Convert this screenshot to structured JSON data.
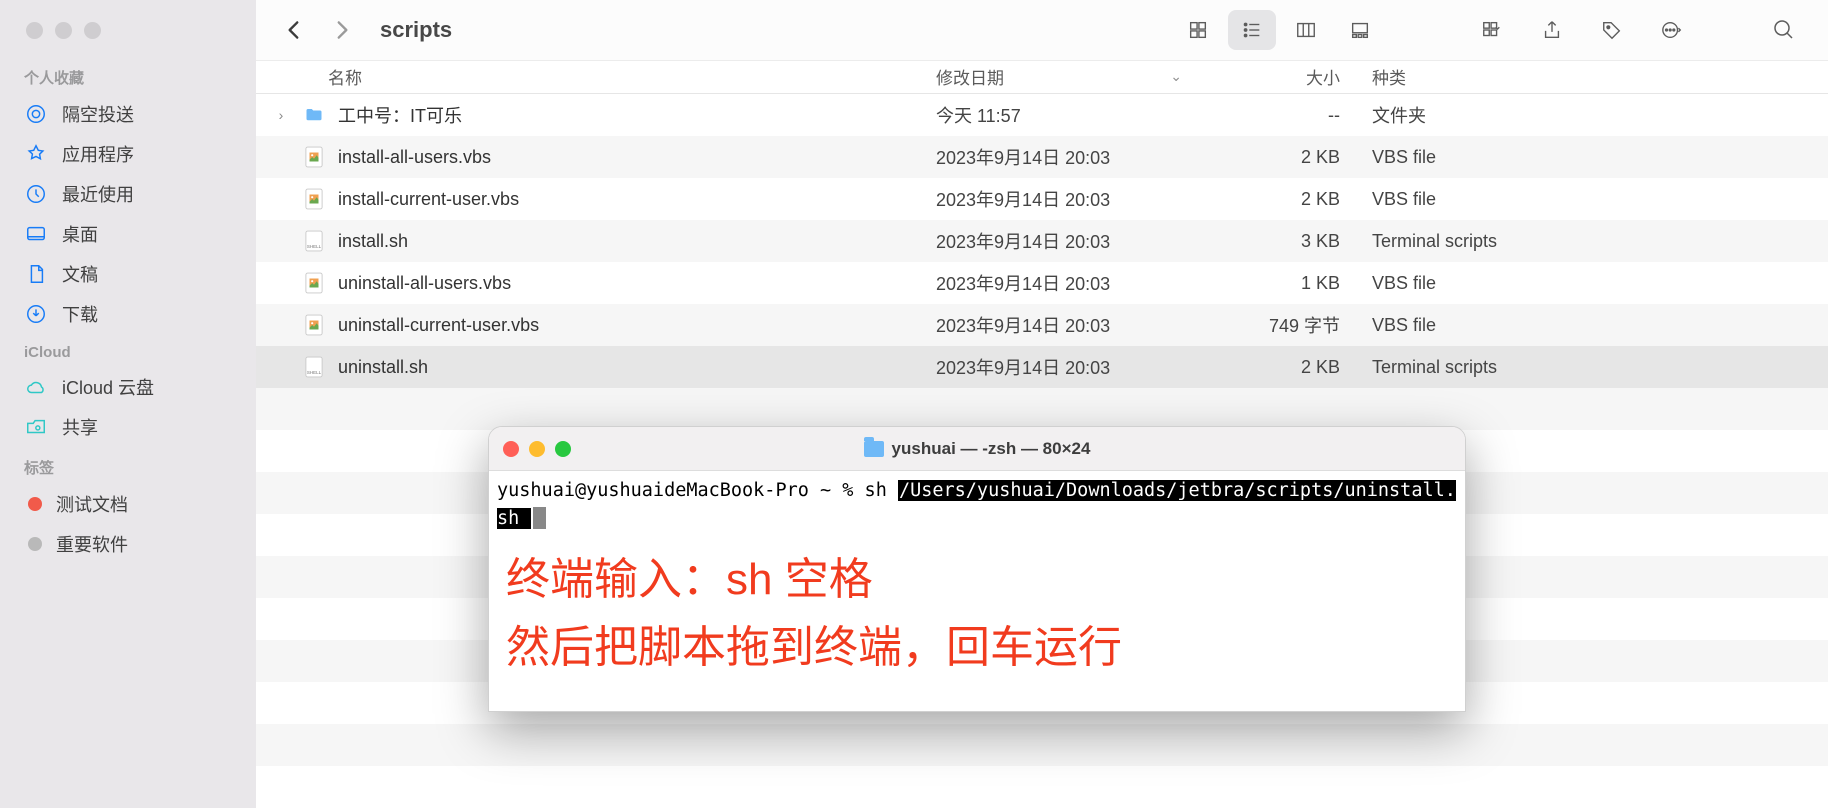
{
  "sidebar": {
    "sections": [
      {
        "label": "个人收藏",
        "items": [
          {
            "icon": "airdrop",
            "label": "隔空投送"
          },
          {
            "icon": "apps",
            "label": "应用程序"
          },
          {
            "icon": "recent",
            "label": "最近使用"
          },
          {
            "icon": "desktop",
            "label": "桌面"
          },
          {
            "icon": "documents",
            "label": "文稿"
          },
          {
            "icon": "downloads",
            "label": "下载"
          }
        ]
      },
      {
        "label": "iCloud",
        "items": [
          {
            "icon": "icloud",
            "label": "iCloud 云盘"
          },
          {
            "icon": "shared",
            "label": "共享"
          }
        ]
      },
      {
        "label": "标签",
        "items": [
          {
            "icon": "tag-red",
            "label": "测试文档",
            "color": "#f15a4a"
          },
          {
            "icon": "tag-gray",
            "label": "重要软件",
            "color": "#b9b9b9"
          }
        ]
      }
    ]
  },
  "toolbar": {
    "title": "scripts"
  },
  "columns": {
    "name": "名称",
    "date": "修改日期",
    "size": "大小",
    "kind": "种类"
  },
  "rows": [
    {
      "expand": true,
      "icon": "folder",
      "name": "工中号：IT可乐",
      "date": "今天 11:57",
      "size": "--",
      "kind": "文件夹"
    },
    {
      "expand": false,
      "icon": "vbs",
      "name": "install-all-users.vbs",
      "date": "2023年9月14日 20:03",
      "size": "2 KB",
      "kind": "VBS file"
    },
    {
      "expand": false,
      "icon": "vbs",
      "name": "install-current-user.vbs",
      "date": "2023年9月14日 20:03",
      "size": "2 KB",
      "kind": "VBS file"
    },
    {
      "expand": false,
      "icon": "sh",
      "name": "install.sh",
      "date": "2023年9月14日 20:03",
      "size": "3 KB",
      "kind": "Terminal scripts"
    },
    {
      "expand": false,
      "icon": "vbs",
      "name": "uninstall-all-users.vbs",
      "date": "2023年9月14日 20:03",
      "size": "1 KB",
      "kind": "VBS file"
    },
    {
      "expand": false,
      "icon": "vbs",
      "name": "uninstall-current-user.vbs",
      "date": "2023年9月14日 20:03",
      "size": "749 字节",
      "kind": "VBS file"
    },
    {
      "expand": false,
      "icon": "sh",
      "name": "uninstall.sh",
      "date": "2023年9月14日 20:03",
      "size": "2 KB",
      "kind": "Terminal scripts",
      "selected": true
    }
  ],
  "terminal": {
    "title": "yushuai — -zsh — 80×24",
    "prompt": "yushuai@yushuaideMacBook-Pro ~ % sh ",
    "path": "/Users/yushuai/Downloads/jetbra/scripts/uninstall.sh "
  },
  "annotation": {
    "line1": "终端输入：sh 空格",
    "line2": "然后把脚本拖到终端，回车运行"
  }
}
